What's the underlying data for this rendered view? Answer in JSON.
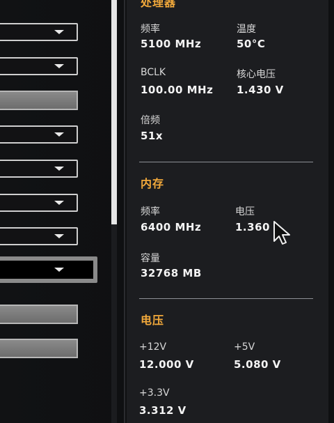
{
  "cpu": {
    "title": "处理器",
    "freq_label": "频率",
    "freq_value": "5100 MHz",
    "temp_label": "温度",
    "temp_value": "50°C",
    "bclk_label": "BCLK",
    "bclk_value": "100.00 MHz",
    "core_voltage_label": "核心电压",
    "core_voltage_value": "1.430 V",
    "ratio_label": "倍频",
    "ratio_value": "51x"
  },
  "memory": {
    "title": "内存",
    "freq_label": "频率",
    "freq_value": "6400 MHz",
    "voltage_label": "电压",
    "voltage_value": "1.360",
    "capacity_label": "容量",
    "capacity_value": "32768 MB"
  },
  "voltage": {
    "title": "电压",
    "v12_label": "+12V",
    "v12_value": "12.000 V",
    "v5_label": "+5V",
    "v5_value": "5.080 V",
    "v33_label": "+3.3V",
    "v33_value": "3.312 V"
  },
  "colors": {
    "accent": "#f2a93b",
    "panel_bg": "#1c1d20",
    "text": "#f4f4f4"
  },
  "icons": {
    "dropdown": "chevron-down-icon",
    "cursor": "mouse-pointer-icon"
  }
}
